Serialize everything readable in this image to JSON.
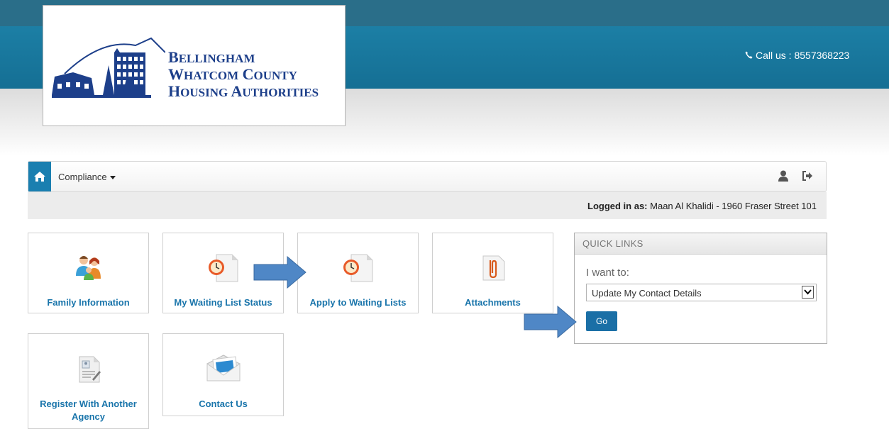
{
  "header": {
    "logo_lines": [
      "Bellingham",
      "Whatcom County",
      "Housing Authorities"
    ],
    "call_label": "Call us : 8557368223"
  },
  "nav": {
    "home_icon": "home-icon",
    "compliance_label": "Compliance",
    "user_icon": "user-icon",
    "signout_icon": "sign-out-icon"
  },
  "logged_in": {
    "label": "Logged in as:",
    "value": "Maan Al Khalidi - 1960 Fraser Street 101"
  },
  "tiles": [
    {
      "label": "Family Information",
      "icon": "family-icon"
    },
    {
      "label": "My Waiting List Status",
      "icon": "clock-document-icon"
    },
    {
      "label": "Apply to Waiting Lists",
      "icon": "clock-document-icon"
    },
    {
      "label": "Attachments",
      "icon": "paperclip-icon"
    },
    {
      "label": "Register With Another Agency",
      "icon": "register-form-icon"
    },
    {
      "label": "Contact Us",
      "icon": "envelope-icon"
    }
  ],
  "quick_links": {
    "title": "QUICK LINKS",
    "prompt": "I want to:",
    "selected": "Update My Contact Details",
    "go_label": "Go"
  },
  "colors": {
    "header_band": "#1c7fa5",
    "link_blue": "#1a75ab",
    "button_blue": "#1a6fa6",
    "arrow_fill": "#4f87c6",
    "logo_navy": "#1d3f8a"
  }
}
